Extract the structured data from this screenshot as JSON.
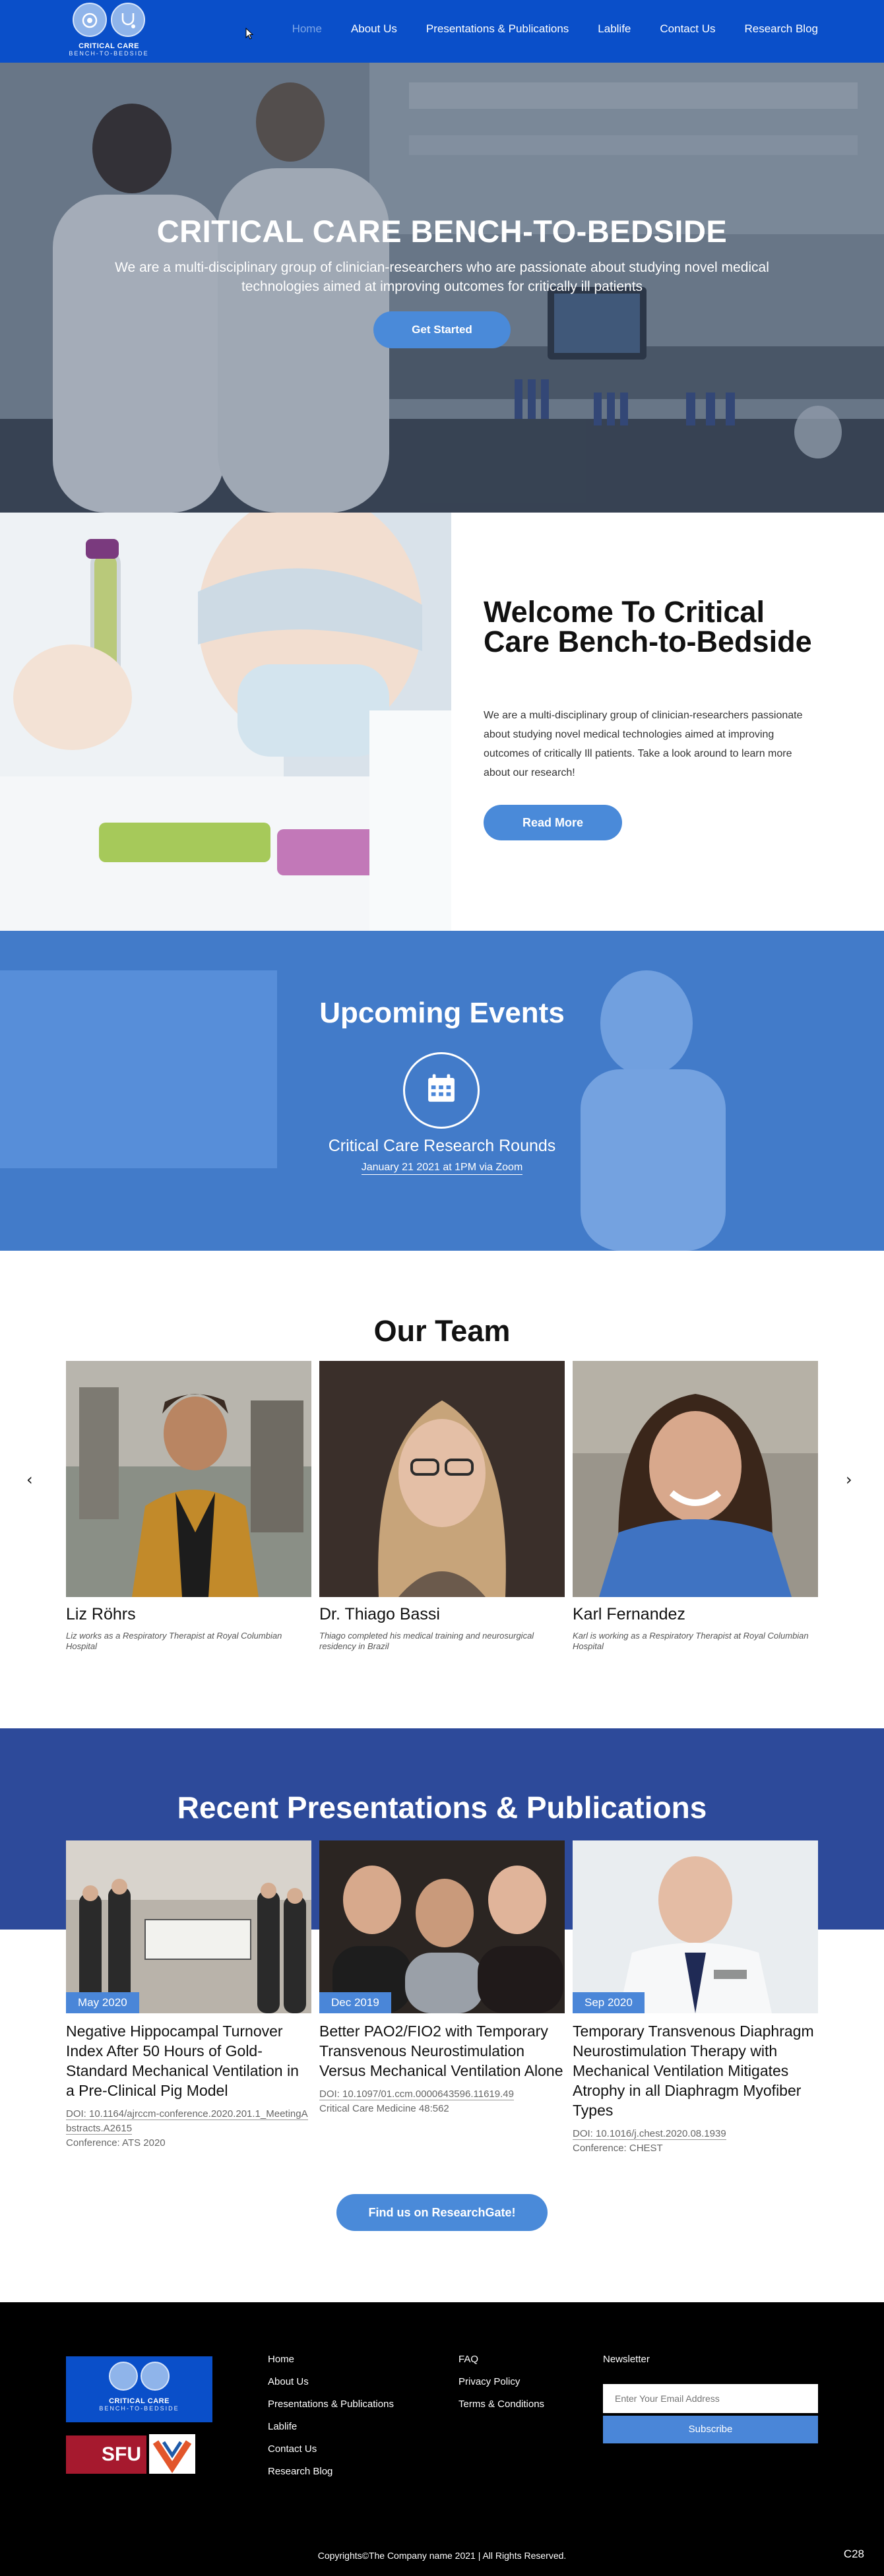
{
  "brand": {
    "logo_title": "CRITICAL CARE",
    "logo_sub": "BENCH-TO-BEDSIDE",
    "accent": "#0a4fc9",
    "secondary": "#4a86d8",
    "band": "#2d4a9a"
  },
  "nav": [
    {
      "label": "Home",
      "active": true
    },
    {
      "label": "About Us"
    },
    {
      "label": "Presentations & Publications"
    },
    {
      "label": "Lablife"
    },
    {
      "label": "Contact Us"
    },
    {
      "label": "Research Blog"
    }
  ],
  "hero": {
    "title": "CRITICAL CARE BENCH-TO-BEDSIDE",
    "text": "We are a multi-disciplinary group of clinician-researchers who are passionate about studying novel medical technologies aimed at improving outcomes for critically ill patients",
    "button": "Get Started"
  },
  "welcome": {
    "title": "Welcome To Critical Care Bench-to-Bedside",
    "text": "We are a multi-disciplinary group of clinician-researchers passionate about studying novel medical technologies aimed at improving outcomes of critically Ill patients. Take a look around to learn more about our research!",
    "button": "Read More"
  },
  "events": {
    "title": "Upcoming Events",
    "icon": "calendar-icon",
    "name": "Critical Care Research Rounds",
    "date": "January 21 2021 at 1PM via Zoom"
  },
  "team": {
    "title": "Our Team",
    "prev": "‹",
    "next": "›",
    "members": [
      {
        "name": "Liz Röhrs",
        "bio": "Liz works as a Respiratory Therapist at Royal Columbian Hospital"
      },
      {
        "name": "Dr. Thiago Bassi",
        "bio": "Thiago completed his medical training and neurosurgical residency in Brazil"
      },
      {
        "name": "Karl Fernandez",
        "bio": "Karl is working as a Respiratory Therapist at Royal Columbian Hospital"
      }
    ]
  },
  "pubs": {
    "title": "Recent Presentations & Publications",
    "items": [
      {
        "badge": "May 2020",
        "title": "Negative Hippocampal Turnover Index After 50 Hours of Gold-Standard Mechanical Ventilation in a Pre-Clinical Pig Model",
        "doi": "DOI: 10.1164/ajrccm-conference.2020.201.1_MeetingAbstracts.A2615",
        "conf": "Conference: ATS 2020"
      },
      {
        "badge": "Dec 2019",
        "title": "Better PAO2/FIO2 with Temporary Transvenous Neurostimulation Versus Mechanical Ventilation Alone",
        "doi": "DOI: 10.1097/01.ccm.0000643596.11619.49",
        "conf": "Critical Care Medicine 48:562"
      },
      {
        "badge": "Sep 2020",
        "title": "Temporary Transvenous Diaphragm Neurostimulation Therapy with Mechanical Ventilation Mitigates Atrophy in all Diaphragm Myofiber Types",
        "doi": "DOI: 10.1016/j.chest.2020.08.1939",
        "conf": "Conference: CHEST"
      }
    ],
    "button": "Find us on ResearchGate!"
  },
  "footer": {
    "sfu": "SFU",
    "col1": [
      "Home",
      "About Us",
      "Presentations & Publications",
      "Lablife",
      "Contact Us",
      "Research Blog"
    ],
    "col2": [
      "FAQ",
      "Privacy Policy",
      "Terms & Conditions"
    ],
    "newsletter_label": "Newsletter",
    "email_placeholder": "Enter Your Email Address",
    "subscribe": "Subscribe",
    "copyright": "Copyrights©The Company name 2021 | All Rights Reserved.",
    "badge": "C28"
  }
}
